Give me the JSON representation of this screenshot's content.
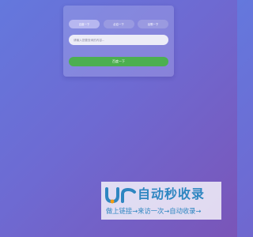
{
  "tabs": [
    {
      "label": "百度一下",
      "active": true
    },
    {
      "label": "必应一下",
      "active": false
    },
    {
      "label": "谷歌一下",
      "active": false
    }
  ],
  "search": {
    "placeholder": "请输入您要查询的内容..."
  },
  "submit": {
    "label": "百度一下"
  },
  "watermark": {
    "brand": "自动秒收录",
    "tagline": "做上链接→来访一次→自动收录→",
    "color": "#2e86c1",
    "logo_icon": "ur-logo-icon"
  },
  "colors": {
    "background_start": "#6478dd",
    "background_end": "#7a55b8",
    "submit": "#4caf50"
  }
}
